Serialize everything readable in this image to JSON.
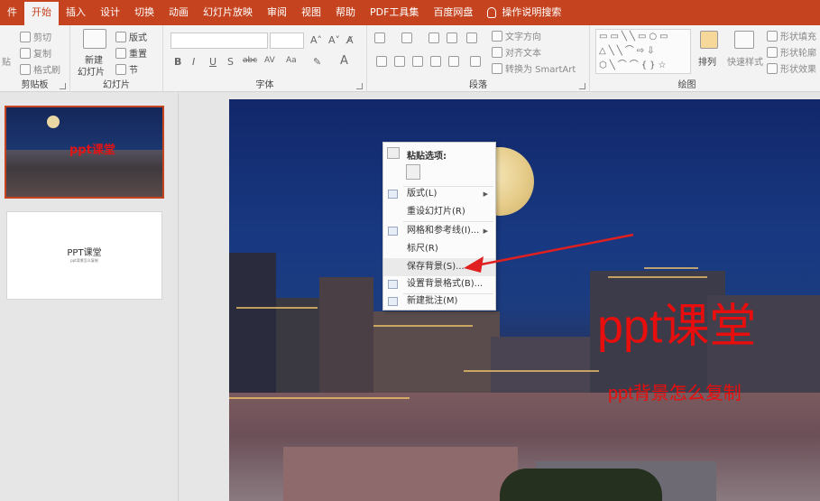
{
  "tabs": [
    "件",
    "开始",
    "插入",
    "设计",
    "切换",
    "动画",
    "幻灯片放映",
    "审阅",
    "视图",
    "帮助",
    "PDF工具集",
    "百度网盘",
    "操作说明搜索"
  ],
  "active_tab_index": 1,
  "ribbon": {
    "clipboard": {
      "paste": "贴",
      "cut": "剪切",
      "copy": "复制",
      "format_painter": "格式刷",
      "label": "剪贴板"
    },
    "slides": {
      "new_slide": "新建",
      "new_slide_2": "幻灯片",
      "layout": "版式",
      "reset": "重置",
      "section": "节",
      "label": "幻灯片"
    },
    "font": {
      "bold": "B",
      "italic": "I",
      "underline": "U",
      "shadow": "S",
      "strike": "abc",
      "spacing": "AV",
      "case": "Aa",
      "color": "A",
      "label": "字体"
    },
    "paragraph": {
      "text_direction": "文字方向",
      "align_text": "对齐文本",
      "smartart": "转换为 SmartArt",
      "label": "段落"
    },
    "drawing": {
      "arrange": "排列",
      "quick_styles": "快速样式",
      "shape_fill": "形状填充",
      "shape_outline": "形状轮廓",
      "shape_effects": "形状效果",
      "label": "绘图"
    }
  },
  "thumbnails": [
    {
      "number": "1",
      "title": "ppt课堂"
    },
    {
      "number": "2",
      "title": "PPT课堂",
      "subtitle": "ppt背景怎么复制"
    }
  ],
  "slide": {
    "title": "ppt课堂",
    "subtitle": "ppt背景怎么复制"
  },
  "context_menu": {
    "header": "粘贴选项:",
    "items": [
      {
        "label": "版式(L)",
        "submenu": true,
        "enabled": true
      },
      {
        "label": "重设幻灯片(R)",
        "submenu": false,
        "enabled": true
      },
      {
        "label": "网格和参考线(I)...",
        "submenu": true,
        "enabled": true
      },
      {
        "label": "标尺(R)",
        "submenu": false,
        "enabled": true
      },
      {
        "label": "保存背景(S)...",
        "submenu": false,
        "enabled": true
      },
      {
        "label": "设置背景格式(B)...",
        "submenu": false,
        "enabled": true
      },
      {
        "label": "新建批注(M)",
        "submenu": false,
        "enabled": true
      }
    ]
  },
  "colors": {
    "accent": "#c5431f",
    "slide_title": "#e80e0e",
    "annotation": "#e02020"
  }
}
